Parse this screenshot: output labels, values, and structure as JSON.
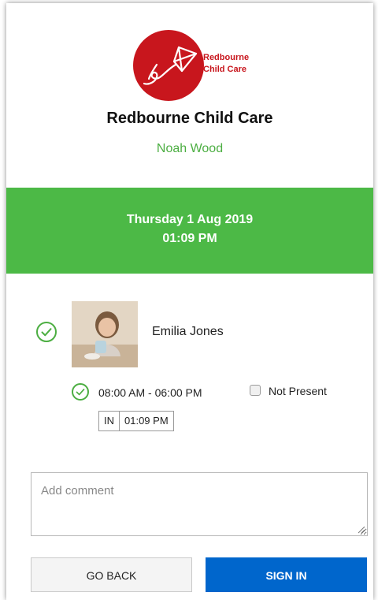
{
  "brand": {
    "logo_line1": "Redbourne",
    "logo_line2": "Child Care",
    "center_name": "Redbourne Child Care",
    "user_name": "Noah Wood",
    "brand_color": "#c8161d",
    "accent_green": "#4cb946"
  },
  "banner": {
    "date": "Thursday 1 Aug 2019",
    "time": "01:09 PM"
  },
  "child": {
    "name": "Emilia Jones",
    "selected": true,
    "schedule_start": "08:00 AM",
    "schedule_sep": "-",
    "schedule_end": "06:00 PM",
    "not_present_label": "Not Present",
    "not_present_checked": false,
    "in_label": "IN",
    "in_time": "01:09 PM"
  },
  "comment": {
    "placeholder": "Add comment",
    "value": ""
  },
  "actions": {
    "go_back": "GO BACK",
    "sign_in": "SIGN IN",
    "sign_in_color": "#0066cc"
  }
}
